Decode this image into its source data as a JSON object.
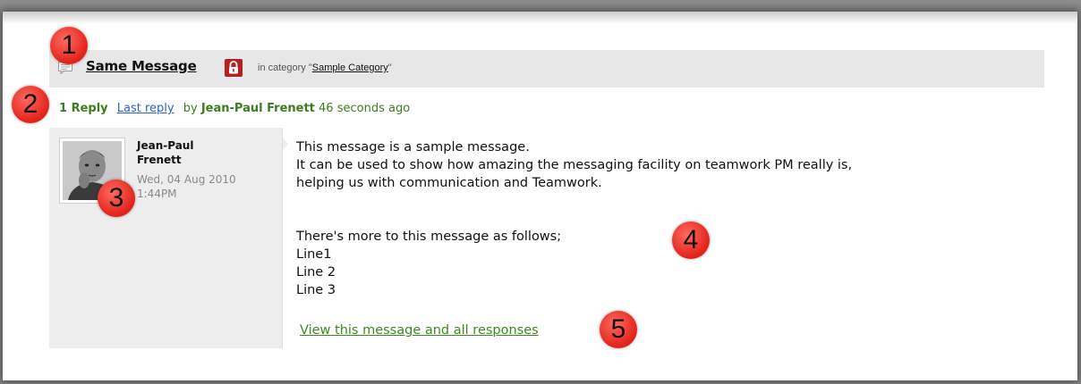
{
  "message": {
    "title": "Same Message",
    "category_prefix": "in category \"",
    "category_name": "Sample Category",
    "category_suffix": "\"",
    "icon": "speech-bubble-icon",
    "lock_icon": "lock-icon"
  },
  "replies": {
    "count_label": "1 Reply",
    "last_reply_label": "Last reply",
    "by_label": "by",
    "author": "Jean-Paul Frenett",
    "ago": "46 seconds ago"
  },
  "author_panel": {
    "name": "Jean-Paul Frenett",
    "date": "Wed, 04 Aug 2010 1:44PM",
    "avatar": "user-photo"
  },
  "body": {
    "lines": [
      "This message is a sample message.",
      "It can be used to show how amazing the messaging facility on teamwork PM really is,",
      "helping us with communication and Teamwork."
    ],
    "lines2": [
      "There's more to this message as follows;",
      "Line1",
      "Line 2",
      "Line 3"
    ]
  },
  "view_link": "View this message and all responses",
  "badges": [
    "1",
    "2",
    "3",
    "4",
    "5"
  ],
  "colors": {
    "green": "#3d7d1e",
    "link_blue": "#2a63c9",
    "badge_red": "#e2221a",
    "lock_red": "#b81f1f"
  }
}
